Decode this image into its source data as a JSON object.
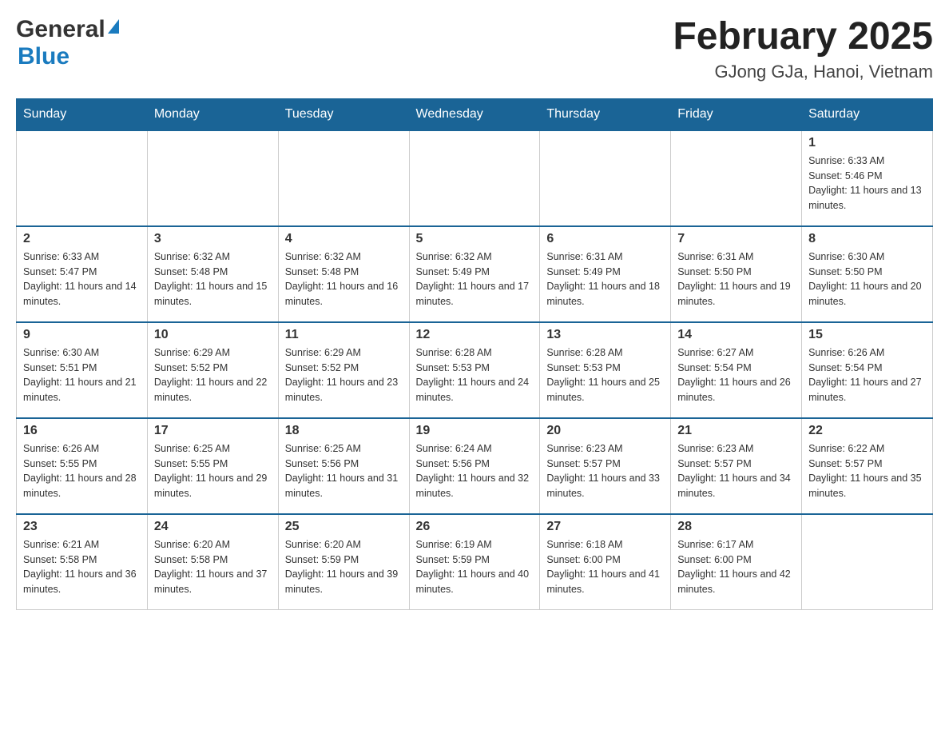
{
  "header": {
    "logo_general": "General",
    "logo_blue": "Blue",
    "month_title": "February 2025",
    "location": "GJong GJa, Hanoi, Vietnam"
  },
  "weekdays": [
    "Sunday",
    "Monday",
    "Tuesday",
    "Wednesday",
    "Thursday",
    "Friday",
    "Saturday"
  ],
  "weeks": [
    [
      {
        "day": "",
        "sunrise": "",
        "sunset": "",
        "daylight": ""
      },
      {
        "day": "",
        "sunrise": "",
        "sunset": "",
        "daylight": ""
      },
      {
        "day": "",
        "sunrise": "",
        "sunset": "",
        "daylight": ""
      },
      {
        "day": "",
        "sunrise": "",
        "sunset": "",
        "daylight": ""
      },
      {
        "day": "",
        "sunrise": "",
        "sunset": "",
        "daylight": ""
      },
      {
        "day": "",
        "sunrise": "",
        "sunset": "",
        "daylight": ""
      },
      {
        "day": "1",
        "sunrise": "Sunrise: 6:33 AM",
        "sunset": "Sunset: 5:46 PM",
        "daylight": "Daylight: 11 hours and 13 minutes."
      }
    ],
    [
      {
        "day": "2",
        "sunrise": "Sunrise: 6:33 AM",
        "sunset": "Sunset: 5:47 PM",
        "daylight": "Daylight: 11 hours and 14 minutes."
      },
      {
        "day": "3",
        "sunrise": "Sunrise: 6:32 AM",
        "sunset": "Sunset: 5:48 PM",
        "daylight": "Daylight: 11 hours and 15 minutes."
      },
      {
        "day": "4",
        "sunrise": "Sunrise: 6:32 AM",
        "sunset": "Sunset: 5:48 PM",
        "daylight": "Daylight: 11 hours and 16 minutes."
      },
      {
        "day": "5",
        "sunrise": "Sunrise: 6:32 AM",
        "sunset": "Sunset: 5:49 PM",
        "daylight": "Daylight: 11 hours and 17 minutes."
      },
      {
        "day": "6",
        "sunrise": "Sunrise: 6:31 AM",
        "sunset": "Sunset: 5:49 PM",
        "daylight": "Daylight: 11 hours and 18 minutes."
      },
      {
        "day": "7",
        "sunrise": "Sunrise: 6:31 AM",
        "sunset": "Sunset: 5:50 PM",
        "daylight": "Daylight: 11 hours and 19 minutes."
      },
      {
        "day": "8",
        "sunrise": "Sunrise: 6:30 AM",
        "sunset": "Sunset: 5:50 PM",
        "daylight": "Daylight: 11 hours and 20 minutes."
      }
    ],
    [
      {
        "day": "9",
        "sunrise": "Sunrise: 6:30 AM",
        "sunset": "Sunset: 5:51 PM",
        "daylight": "Daylight: 11 hours and 21 minutes."
      },
      {
        "day": "10",
        "sunrise": "Sunrise: 6:29 AM",
        "sunset": "Sunset: 5:52 PM",
        "daylight": "Daylight: 11 hours and 22 minutes."
      },
      {
        "day": "11",
        "sunrise": "Sunrise: 6:29 AM",
        "sunset": "Sunset: 5:52 PM",
        "daylight": "Daylight: 11 hours and 23 minutes."
      },
      {
        "day": "12",
        "sunrise": "Sunrise: 6:28 AM",
        "sunset": "Sunset: 5:53 PM",
        "daylight": "Daylight: 11 hours and 24 minutes."
      },
      {
        "day": "13",
        "sunrise": "Sunrise: 6:28 AM",
        "sunset": "Sunset: 5:53 PM",
        "daylight": "Daylight: 11 hours and 25 minutes."
      },
      {
        "day": "14",
        "sunrise": "Sunrise: 6:27 AM",
        "sunset": "Sunset: 5:54 PM",
        "daylight": "Daylight: 11 hours and 26 minutes."
      },
      {
        "day": "15",
        "sunrise": "Sunrise: 6:26 AM",
        "sunset": "Sunset: 5:54 PM",
        "daylight": "Daylight: 11 hours and 27 minutes."
      }
    ],
    [
      {
        "day": "16",
        "sunrise": "Sunrise: 6:26 AM",
        "sunset": "Sunset: 5:55 PM",
        "daylight": "Daylight: 11 hours and 28 minutes."
      },
      {
        "day": "17",
        "sunrise": "Sunrise: 6:25 AM",
        "sunset": "Sunset: 5:55 PM",
        "daylight": "Daylight: 11 hours and 29 minutes."
      },
      {
        "day": "18",
        "sunrise": "Sunrise: 6:25 AM",
        "sunset": "Sunset: 5:56 PM",
        "daylight": "Daylight: 11 hours and 31 minutes."
      },
      {
        "day": "19",
        "sunrise": "Sunrise: 6:24 AM",
        "sunset": "Sunset: 5:56 PM",
        "daylight": "Daylight: 11 hours and 32 minutes."
      },
      {
        "day": "20",
        "sunrise": "Sunrise: 6:23 AM",
        "sunset": "Sunset: 5:57 PM",
        "daylight": "Daylight: 11 hours and 33 minutes."
      },
      {
        "day": "21",
        "sunrise": "Sunrise: 6:23 AM",
        "sunset": "Sunset: 5:57 PM",
        "daylight": "Daylight: 11 hours and 34 minutes."
      },
      {
        "day": "22",
        "sunrise": "Sunrise: 6:22 AM",
        "sunset": "Sunset: 5:57 PM",
        "daylight": "Daylight: 11 hours and 35 minutes."
      }
    ],
    [
      {
        "day": "23",
        "sunrise": "Sunrise: 6:21 AM",
        "sunset": "Sunset: 5:58 PM",
        "daylight": "Daylight: 11 hours and 36 minutes."
      },
      {
        "day": "24",
        "sunrise": "Sunrise: 6:20 AM",
        "sunset": "Sunset: 5:58 PM",
        "daylight": "Daylight: 11 hours and 37 minutes."
      },
      {
        "day": "25",
        "sunrise": "Sunrise: 6:20 AM",
        "sunset": "Sunset: 5:59 PM",
        "daylight": "Daylight: 11 hours and 39 minutes."
      },
      {
        "day": "26",
        "sunrise": "Sunrise: 6:19 AM",
        "sunset": "Sunset: 5:59 PM",
        "daylight": "Daylight: 11 hours and 40 minutes."
      },
      {
        "day": "27",
        "sunrise": "Sunrise: 6:18 AM",
        "sunset": "Sunset: 6:00 PM",
        "daylight": "Daylight: 11 hours and 41 minutes."
      },
      {
        "day": "28",
        "sunrise": "Sunrise: 6:17 AM",
        "sunset": "Sunset: 6:00 PM",
        "daylight": "Daylight: 11 hours and 42 minutes."
      },
      {
        "day": "",
        "sunrise": "",
        "sunset": "",
        "daylight": ""
      }
    ]
  ]
}
